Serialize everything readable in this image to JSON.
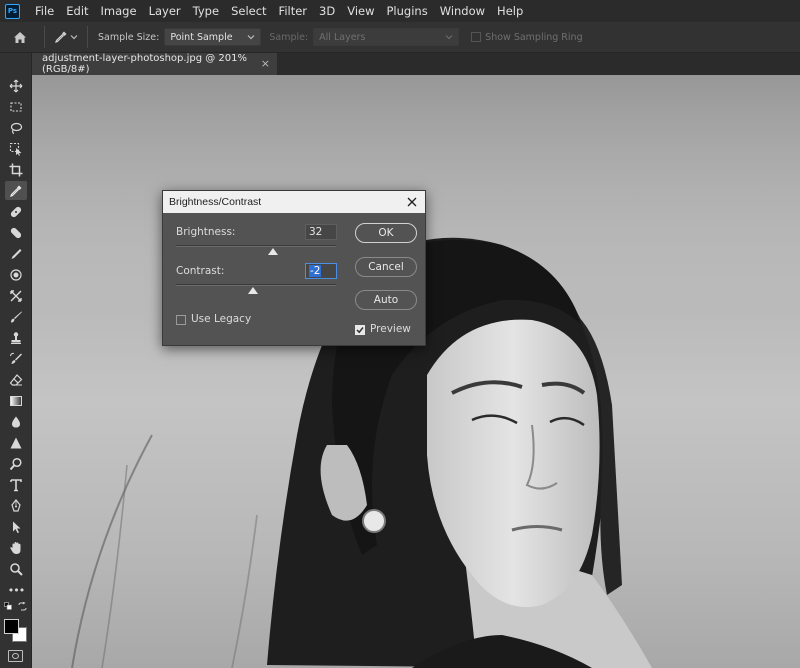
{
  "app": {
    "logo": "Ps"
  },
  "menu": [
    "File",
    "Edit",
    "Image",
    "Layer",
    "Type",
    "Select",
    "Filter",
    "3D",
    "View",
    "Plugins",
    "Window",
    "Help"
  ],
  "options_bar": {
    "sample_size_label": "Sample Size:",
    "sample_size_value": "Point Sample",
    "sample_label": "Sample:",
    "sample_value": "All Layers",
    "show_ring_label": "Show Sampling Ring"
  },
  "document_tab": {
    "title": "adjustment-layer-photoshop.jpg @ 201% (RGB/8#)",
    "close": "×"
  },
  "toolbar": {
    "tools": [
      "move-icon",
      "marquee-icon",
      "lasso-icon",
      "object-select-icon",
      "crop-icon",
      "eyedropper-icon",
      "spot-heal-icon",
      "healing-brush-icon",
      "clone-icon",
      "pattern-icon",
      "content-aware-move-icon",
      "brush-icon",
      "stamp-icon",
      "history-brush-icon",
      "eraser-icon",
      "gradient-icon",
      "blur-icon",
      "sharpen-icon",
      "dodge-icon",
      "type-icon",
      "pen-icon",
      "path-select-icon",
      "hand-icon",
      "zoom-icon",
      "more-tools-icon"
    ],
    "extra": "•••"
  },
  "dialog": {
    "title": "Brightness/Contrast",
    "brightness_label": "Brightness:",
    "brightness_value": "32",
    "contrast_label": "Contrast:",
    "contrast_value": "-2",
    "ok_label": "OK",
    "cancel_label": "Cancel",
    "auto_label": "Auto",
    "use_legacy_label": "Use Legacy",
    "use_legacy_checked": false,
    "preview_label": "Preview",
    "preview_checked": true
  },
  "colors": {
    "foreground": "#000000",
    "background": "#ffffff",
    "accent": "#31a8ff"
  }
}
